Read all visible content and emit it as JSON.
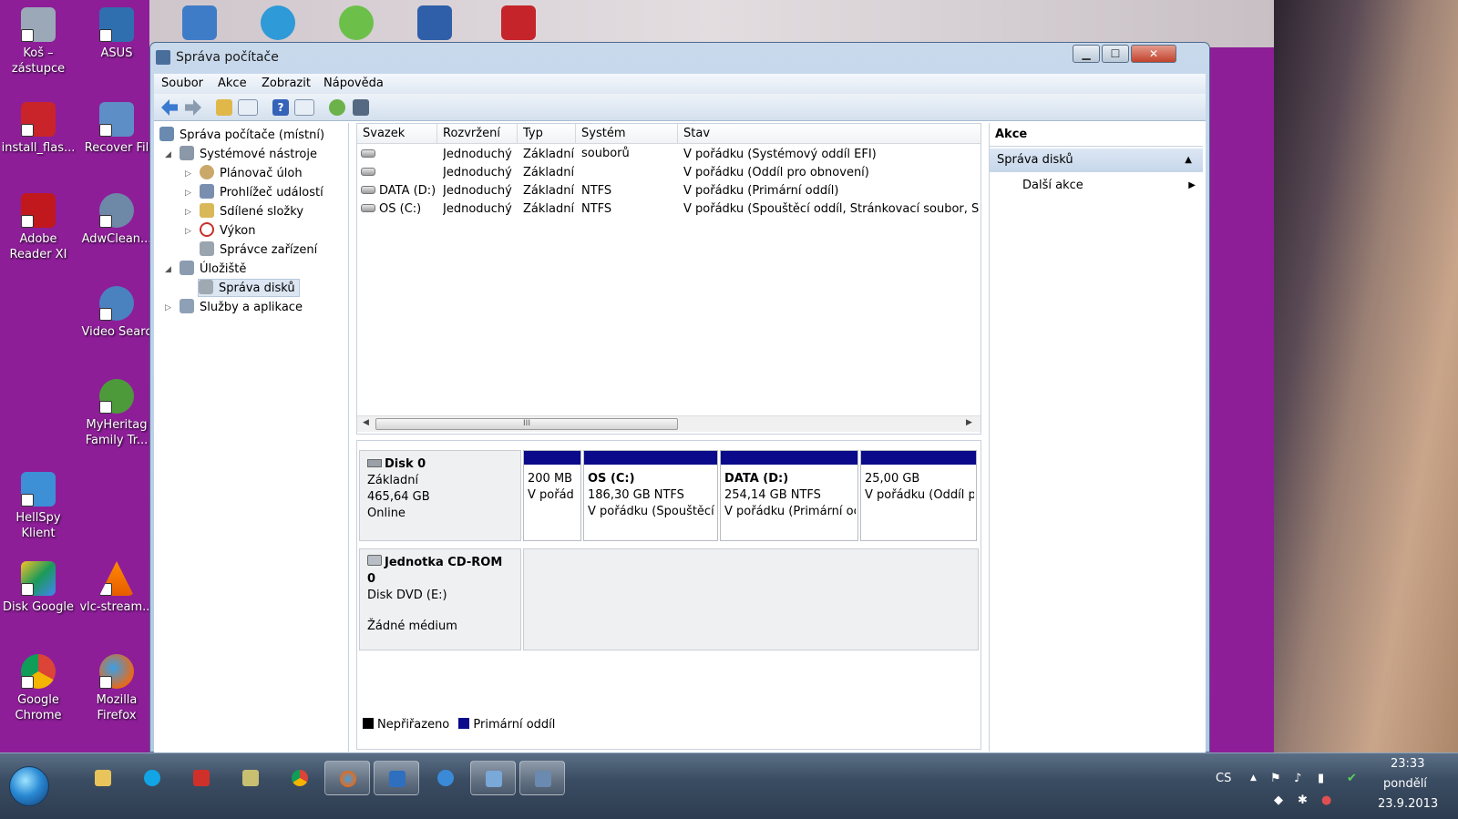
{
  "desktop": {
    "icons_left": [
      {
        "label": "Koš –\nzástupce"
      },
      {
        "label": "install_flas..."
      },
      {
        "label": "Adobe\nReader XI"
      },
      {
        "label": "HellSpy\nKlient"
      },
      {
        "label": "Disk Google"
      },
      {
        "label": "Google\nChrome"
      }
    ],
    "icons_right": [
      {
        "label": "ASUS"
      },
      {
        "label": "Recover Fil"
      },
      {
        "label": "AdwClean..."
      },
      {
        "label": "Video Searc"
      },
      {
        "label": "MyHeritag\nFamily Tr..."
      },
      {
        "label": "vlc-stream..."
      },
      {
        "label": "Mozilla\nFirefox"
      }
    ]
  },
  "window": {
    "title": "Správa počítače",
    "min_label": "▁",
    "max_label": "☐",
    "close_label": "✕"
  },
  "menu": {
    "items": [
      "Soubor",
      "Akce",
      "Zobrazit",
      "Nápověda"
    ]
  },
  "tree": {
    "root": "Správa počítače (místní)",
    "system_tools": "Systémové nástroje",
    "task_scheduler": "Plánovač úloh",
    "event_viewer": "Prohlížeč událostí",
    "shared_folders": "Sdílené složky",
    "performance": "Výkon",
    "device_manager": "Správce zařízení",
    "storage": "Úložiště",
    "disk_management": "Správa disků",
    "services": "Služby a aplikace"
  },
  "volume_list": {
    "columns": [
      "Svazek",
      "Rozvržení",
      "Typ",
      "Systém souborů",
      "Stav"
    ],
    "rows": [
      {
        "volume": "",
        "layout": "Jednoduchý",
        "type": "Základní",
        "fs": "",
        "status": "V pořádku (Systémový oddíl EFI)"
      },
      {
        "volume": "",
        "layout": "Jednoduchý",
        "type": "Základní",
        "fs": "",
        "status": "V pořádku (Oddíl pro obnovení)"
      },
      {
        "volume": "DATA (D:)",
        "layout": "Jednoduchý",
        "type": "Základní",
        "fs": "NTFS",
        "status": "V pořádku (Primární oddíl)"
      },
      {
        "volume": "OS (C:)",
        "layout": "Jednoduchý",
        "type": "Základní",
        "fs": "NTFS",
        "status": "V pořádku (Spouštěcí oddíl, Stránkovací soubor, Stav"
      }
    ],
    "scroll_thumb_label": "III"
  },
  "disk0": {
    "name": "Disk 0",
    "type": "Základní",
    "size": "465,64 GB",
    "status": "Online",
    "partitions": [
      {
        "name": "",
        "size": "200 MB",
        "status": "V pořád"
      },
      {
        "name": "OS  (C:)",
        "size": "186,30 GB NTFS",
        "status": "V pořádku (Spouštěcí"
      },
      {
        "name": "DATA  (D:)",
        "size": "254,14 GB NTFS",
        "status": "V pořádku (Primární oc"
      },
      {
        "name": "",
        "size": "25,00 GB",
        "status": "V pořádku (Oddíl p"
      }
    ]
  },
  "cdrom": {
    "name": "Jednotka CD-ROM 0",
    "drive": "Disk DVD (E:)",
    "media": "Žádné médium"
  },
  "legend": {
    "unallocated": "Nepřiřazeno",
    "primary": "Primární oddíl"
  },
  "actions": {
    "header": "Akce",
    "section": "Správa disků",
    "more": "Další akce"
  },
  "taskbar": {
    "lang": "CS",
    "time": "23:33",
    "day": "pondělí",
    "date": "23.9.2013"
  },
  "colors": {
    "desktop": "#8d1e98",
    "primary_partition": "#0a0a8a",
    "unallocated": "#000000"
  }
}
